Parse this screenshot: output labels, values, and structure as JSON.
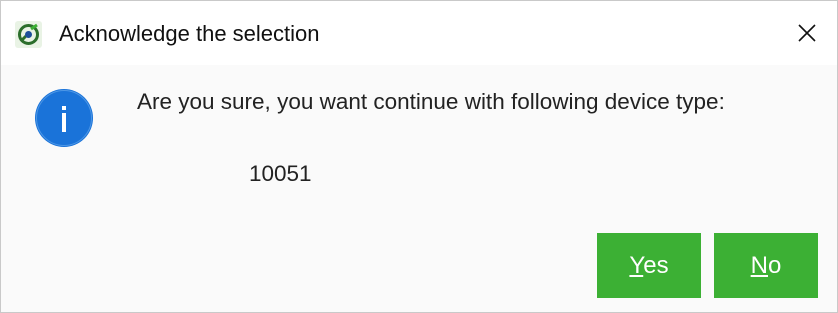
{
  "window": {
    "title": "Acknowledge the selection",
    "app_icon": "app-logo-icon",
    "close_icon": "close-icon"
  },
  "dialog": {
    "icon": "info-icon",
    "message": "Are you sure, you want continue with following device type:",
    "device_type": "10051"
  },
  "buttons": {
    "yes": {
      "mnemonic": "Y",
      "rest": "es"
    },
    "no": {
      "mnemonic": "N",
      "rest": "o"
    }
  },
  "colors": {
    "button_green": "#3cb034",
    "info_blue": "#1a73d9"
  }
}
